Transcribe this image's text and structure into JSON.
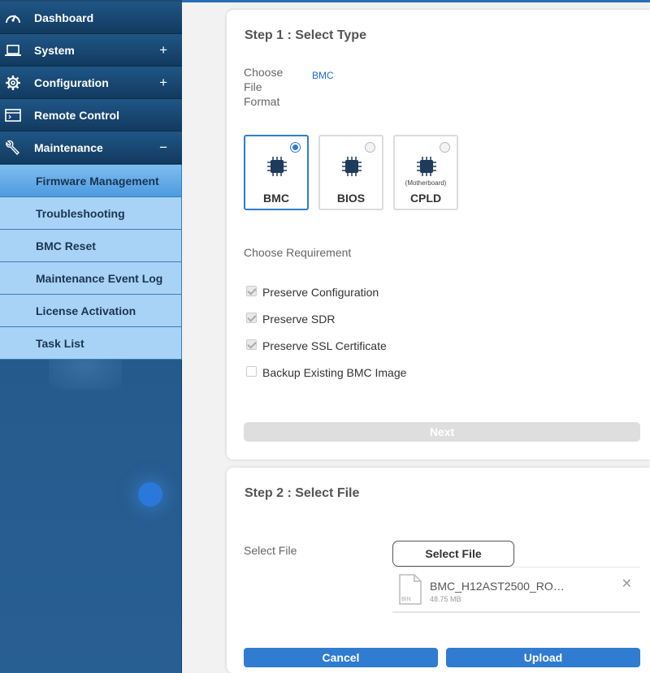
{
  "sidebar": {
    "items": [
      {
        "label": "Dashboard",
        "icon": "speedometer-icon",
        "toggle": ""
      },
      {
        "label": "System",
        "icon": "laptop-icon",
        "toggle": "+"
      },
      {
        "label": "Configuration",
        "icon": "gear-icon",
        "toggle": "+"
      },
      {
        "label": "Remote Control",
        "icon": "console-window-icon",
        "toggle": ""
      },
      {
        "label": "Maintenance",
        "icon": "wrench-icon",
        "toggle": "−"
      }
    ],
    "subitems": [
      {
        "label": "Firmware Management",
        "active": true
      },
      {
        "label": "Troubleshooting"
      },
      {
        "label": "BMC Reset"
      },
      {
        "label": "Maintenance Event Log"
      },
      {
        "label": "License Activation"
      },
      {
        "label": "Task List"
      }
    ]
  },
  "step1": {
    "title": "Step 1 : Select Type",
    "file_format_label": "Choose\nFile\nFormat",
    "file_format_value": "BMC",
    "types": [
      {
        "name": "BMC",
        "sub": "",
        "selected": true
      },
      {
        "name": "BIOS",
        "sub": "",
        "selected": false
      },
      {
        "name": "CPLD",
        "sub": "(Motherboard)",
        "selected": false
      }
    ],
    "requirement_label": "Choose Requirement",
    "options": [
      {
        "label": "Preserve Configuration",
        "checked": true
      },
      {
        "label": "Preserve SDR",
        "checked": true
      },
      {
        "label": "Preserve SSL Certificate",
        "checked": true
      },
      {
        "label": "Backup Existing BMC Image",
        "checked": false
      }
    ],
    "next_label": "Next"
  },
  "step2": {
    "title": "Step 2 : Select File",
    "select_file_label": "Select File",
    "select_file_button": "Select File",
    "file": {
      "name": "BMC_H12AST2500_RO…",
      "size": "48.75 MB",
      "ext": "BIN"
    },
    "cancel_label": "Cancel",
    "upload_label": "Upload"
  },
  "colors": {
    "accent": "#2f7cd1",
    "sidebar": "#1d4a72",
    "submenu": "#a8d3f7"
  }
}
